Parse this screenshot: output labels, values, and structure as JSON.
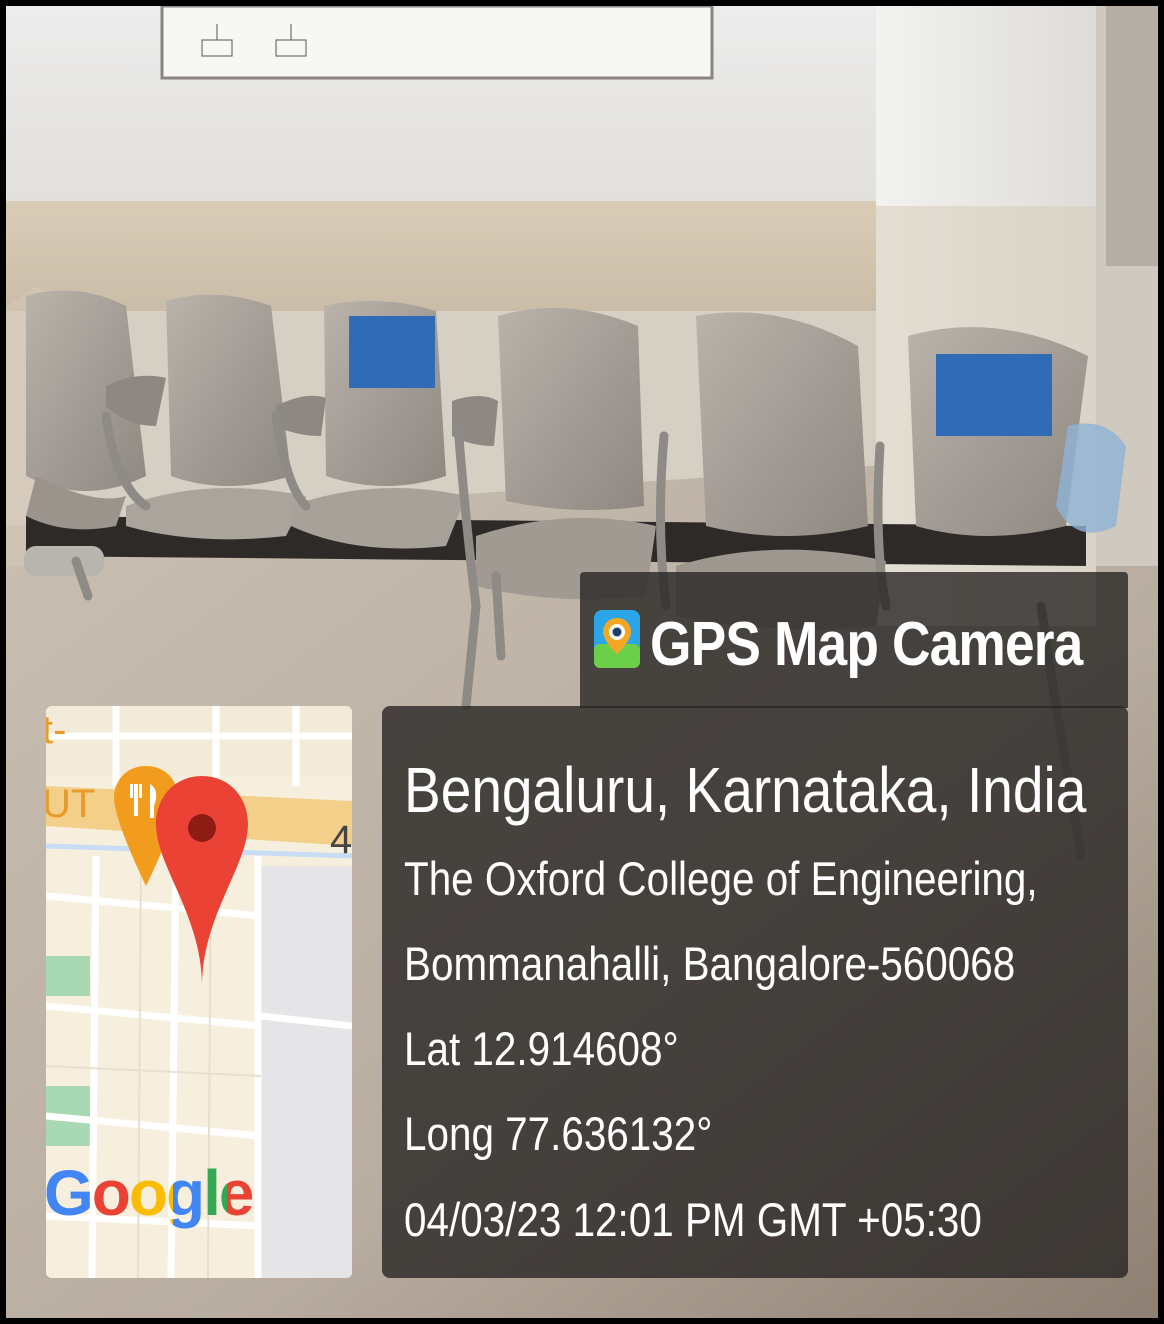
{
  "overlay": {
    "app_name": "GPS Map Camera",
    "location": "Bengaluru, Karnataka, India",
    "address_line1": "The Oxford College of Engineering,",
    "address_line2": "Bommanahalli, Bangalore-560068",
    "latitude": "Lat 12.914608°",
    "longitude": "Long 77.636132°",
    "timestamp": "04/03/23 12:01 PM GMT +05:30"
  },
  "map": {
    "provider_logo": "Google",
    "partial_label_1": "t-",
    "partial_label_2": "UT",
    "road_number": "4",
    "pin_icon": "location-pin-icon",
    "poi_icon": "restaurant-icon"
  },
  "colors": {
    "overlay_bg": "#282624",
    "pin_red": "#ea4335",
    "poi_orange": "#f29c1e"
  }
}
